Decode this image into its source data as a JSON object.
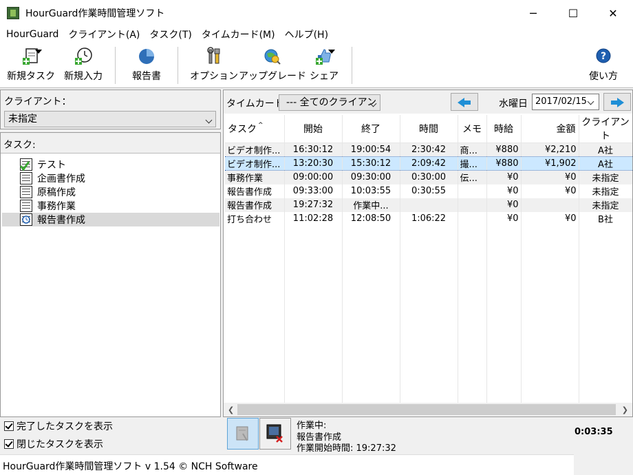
{
  "window": {
    "title": "HourGuard作業時間管理ソフト",
    "controls": [
      "─",
      "☐",
      "✕"
    ]
  },
  "menu": [
    "HourGuard",
    "クライアント(A)",
    "タスク(T)",
    "タイムカード(M)",
    "ヘルプ(H)"
  ],
  "toolbar": {
    "new_task": "新規タスク",
    "new_entry": "新規入力",
    "report": "報告書",
    "options": "オプション",
    "upgrade": "アップグレード",
    "share": "シェア",
    "help": "使い方"
  },
  "client_panel": {
    "label": "クライアント：",
    "selected": "未指定"
  },
  "task_panel": {
    "header": "タスク:",
    "items": [
      "テスト",
      "企画書作成",
      "原稿作成",
      "事務作業",
      "報告書作成"
    ]
  },
  "timecard": {
    "label": "タイムカード",
    "client_filter": "--- 全てのクライアン",
    "day": "水曜日",
    "date": "2017/02/15"
  },
  "table": {
    "headers": [
      "タスク",
      "開始",
      "終了",
      "時間",
      "メモ",
      "時給",
      "金額",
      "クライアント"
    ],
    "rows": [
      [
        "ビデオ制作...",
        "16:30:12",
        "19:00:54",
        "2:30:42",
        "商...",
        "¥880",
        "¥2,210",
        "A社"
      ],
      [
        "ビデオ制作...",
        "13:20:30",
        "15:30:12",
        "2:09:42",
        "撮...",
        "¥880",
        "¥1,902",
        "A社"
      ],
      [
        "事務作業",
        "09:00:00",
        "09:30:00",
        "0:30:00",
        "伝...",
        "¥0",
        "¥0",
        "未指定"
      ],
      [
        "報告書作成",
        "09:33:00",
        "10:03:55",
        "0:30:55",
        "",
        "¥0",
        "¥0",
        "未指定"
      ],
      [
        "報告書作成",
        "19:27:32",
        "作業中...",
        "",
        "",
        "¥0",
        "",
        "未指定"
      ],
      [
        "打ち合わせ",
        "11:02:28",
        "12:08:50",
        "1:06:22",
        "",
        "¥0",
        "¥0",
        "B社"
      ]
    ]
  },
  "options": {
    "show_completed": "完了したタスクを表示",
    "show_closed": "閉じたタスクを表示"
  },
  "status": {
    "line1": "作業中:",
    "line2": "報告書作成",
    "line3": "作業開始時間: 19:27:32",
    "timer": "0:03:35"
  },
  "footer": "HourGuard作業時間管理ソフト v 1.54 © NCH Software"
}
